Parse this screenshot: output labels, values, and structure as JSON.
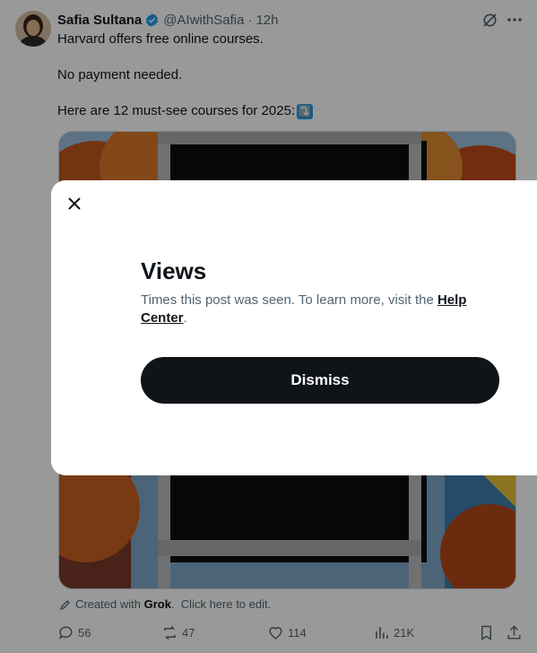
{
  "post": {
    "author_name": "Safia Sultana",
    "handle": "@AIwithSafia",
    "separator": "·",
    "time": "12h",
    "line1": "Harvard offers free online courses.",
    "line2": "No payment needed.",
    "line3": "Here are 12 must-see courses for 2025:",
    "emoji": "⤵️",
    "credit_prefix": "Created with",
    "credit_brand": "Grok",
    "credit_suffix": ".  Click here to edit.",
    "replies": "56",
    "reposts": "47",
    "likes": "114",
    "views": "21K",
    "accent_color": "#1d9bf0"
  },
  "modal": {
    "title": "Views",
    "description": "Times this post was seen. To learn more, visit the ",
    "link_text": "Help Center",
    "description_end": ".",
    "dismiss_label": "Dismiss"
  },
  "icons": [
    "verified-badge-icon",
    "grok-icon",
    "more-icon",
    "close-icon",
    "pencil-icon",
    "reply-icon",
    "repost-icon",
    "like-icon",
    "views-icon",
    "bookmark-icon",
    "share-icon"
  ]
}
